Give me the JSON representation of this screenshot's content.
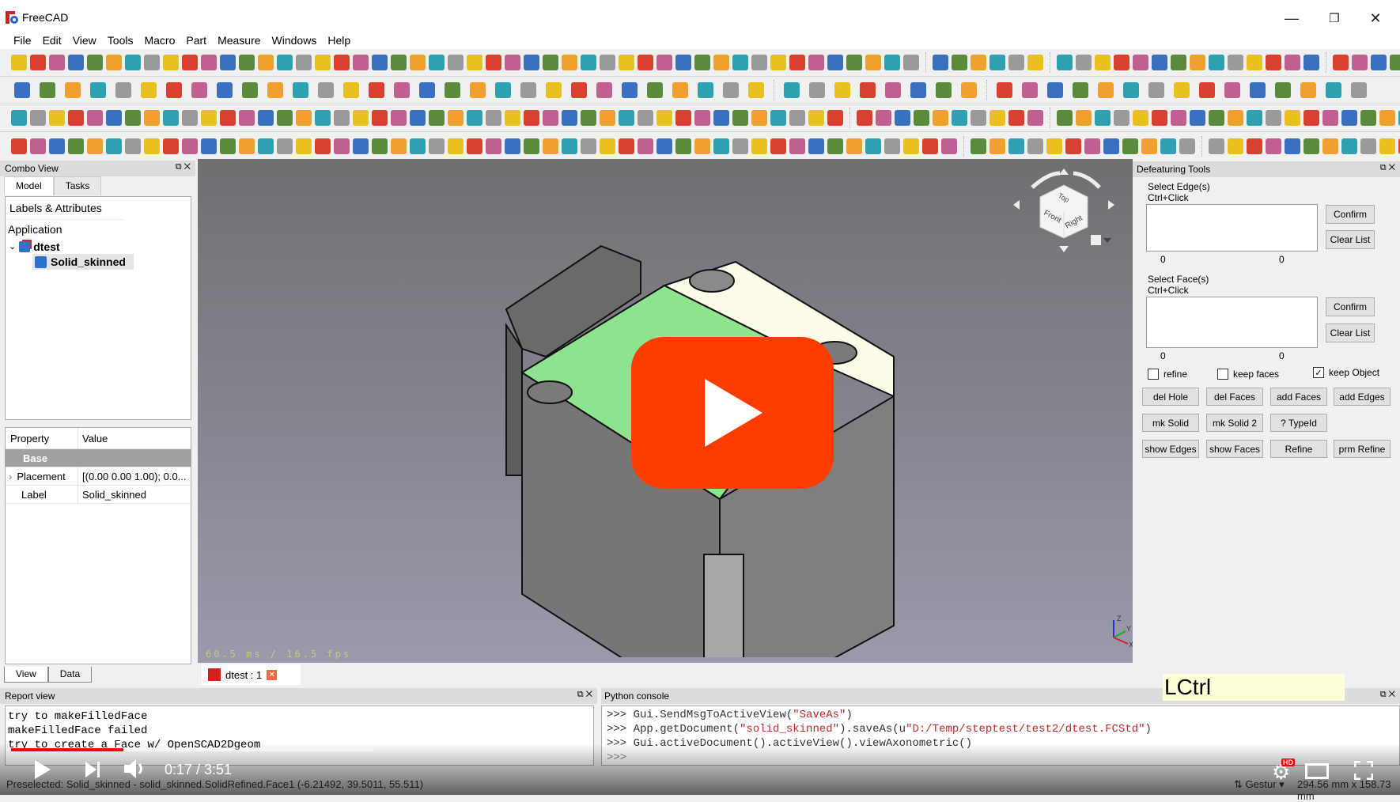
{
  "window": {
    "title": "FreeCAD",
    "controls": [
      "minimize",
      "restore",
      "close"
    ]
  },
  "menu": [
    "File",
    "Edit",
    "View",
    "Tools",
    "Macro",
    "Part",
    "Measure",
    "Windows",
    "Help"
  ],
  "combo_view": {
    "title": "Combo View",
    "tabs": [
      {
        "label": "Model",
        "active": true
      },
      {
        "label": "Tasks",
        "active": false
      }
    ],
    "tree": {
      "header": "Labels & Attributes",
      "root": "Application",
      "document": "dtest",
      "object": "Solid_skinned"
    },
    "properties": {
      "headers": [
        "Property",
        "Value"
      ],
      "group": "Base",
      "rows": [
        {
          "name": "Placement",
          "value": "[(0.00 0.00 1.00); 0.0...",
          "expandable": true
        },
        {
          "name": "Label",
          "value": "Solid_skinned",
          "expandable": false
        }
      ]
    },
    "bottom_tabs": [
      "View",
      "Data"
    ]
  },
  "viewport": {
    "fps": "60.5 ms / 16.5 fps",
    "navcube_faces": [
      "Top",
      "Front",
      "Right"
    ],
    "axis_labels": [
      "Z",
      "Y",
      "X"
    ],
    "document_tab": "dtest : 1"
  },
  "defeaturing": {
    "title": "Defeaturing Tools",
    "edge_section": {
      "label": "Select Edge(s)",
      "hint": "Ctrl+Click",
      "count_left": "0",
      "count_right": "0",
      "confirm": "Confirm",
      "clear": "Clear List"
    },
    "face_section": {
      "label": "Select Face(s)",
      "hint": "Ctrl+Click",
      "count_left": "0",
      "count_right": "0",
      "confirm": "Confirm",
      "clear": "Clear List"
    },
    "checkboxes": [
      {
        "label": "refine",
        "checked": false
      },
      {
        "label": "keep faces",
        "checked": false
      },
      {
        "label": "keep Object",
        "checked": true
      }
    ],
    "buttons": [
      [
        "del Hole",
        "del Faces",
        "add Faces",
        "add Edges"
      ],
      [
        "mk Solid",
        "mk Solid 2",
        "? TypeId"
      ],
      [
        "show Edges",
        "show Faces",
        "Refine",
        "prm Refine"
      ]
    ]
  },
  "report_view": {
    "title": "Report view",
    "lines": [
      "try to makeFilledFace",
      "makeFilledFace failed",
      "try to create a Face w/ OpenSCAD2Dgeom"
    ]
  },
  "python_console": {
    "title": "Python console",
    "lines": [
      {
        "pre": ">>> Gui.SendMsgToActiveView(",
        "str": "\"SaveAs\"",
        "post": ")"
      },
      {
        "pre": ">>> App.getDocument(",
        "str": "\"solid_skinned\"",
        "mid": ").saveAs(u",
        "str2": "\"D:/Temp/steptest/test2/dtest.FCStd\"",
        "post": ")"
      },
      {
        "pre": ">>> Gui.activeDocument().activeView().viewAxonometric()"
      },
      {
        "pre": ">>>"
      }
    ]
  },
  "key_overlay": "LCtrl",
  "status_bar": {
    "message": "Preselected: Solid_skinned - solid_skinned.SolidRefined.Face1 (-6.21492, 39.5011, 55.511)",
    "navigation": "Gestur",
    "dimensions": "294.56 mm x 158.73 mm"
  },
  "video_player": {
    "time_current": "0:17",
    "time_total": "3:51",
    "time_display": "0:17 / 3:51",
    "progress_fraction": 0.074,
    "buffered_fraction": 0.2,
    "quality_badge": "HD",
    "accent": "#ff0000"
  }
}
